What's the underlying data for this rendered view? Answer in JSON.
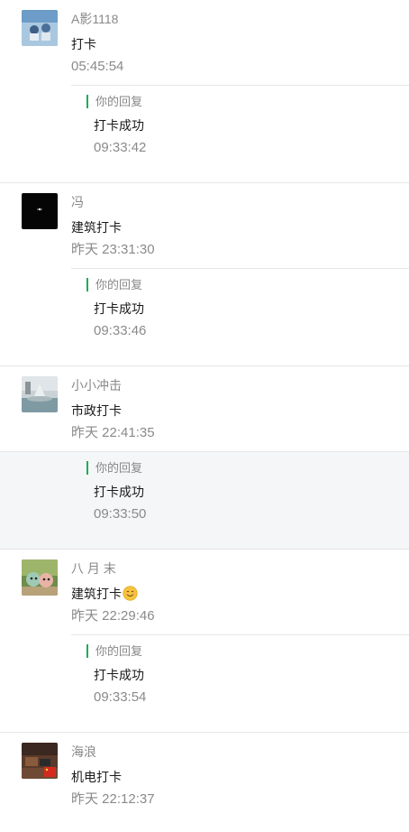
{
  "entries": [
    {
      "name": "A影1118",
      "message": "打卡",
      "time": "05:45:54",
      "avatar_icon": "avatar-beach-photo",
      "reply": {
        "label": "你的回复",
        "text": "打卡成功",
        "time": "09:33:42"
      }
    },
    {
      "name": "冯",
      "message": "建筑打卡",
      "time": "昨天 23:31:30",
      "avatar_icon": "avatar-black-photo",
      "reply": {
        "label": "你的回复",
        "text": "打卡成功",
        "time": "09:33:46"
      }
    },
    {
      "name": "小小冲击",
      "message": "市政打卡",
      "time": "昨天 22:41:35",
      "avatar_icon": "avatar-fountain-photo",
      "reply": {
        "label": "你的回复",
        "text": "打卡成功",
        "time": "09:33:50"
      }
    },
    {
      "name": "八 月 末",
      "message": "建筑打卡",
      "message_emoji": "smiling-face-emoji",
      "time": "昨天 22:29:46",
      "avatar_icon": "avatar-toys-photo",
      "reply": {
        "label": "你的回复",
        "text": "打卡成功",
        "time": "09:33:54"
      }
    },
    {
      "name": "海浪",
      "message": "机电打卡",
      "time": "昨天 22:12:37",
      "avatar_icon": "avatar-room-photo"
    }
  ],
  "colors": {
    "reply_accent": "#1aad5a",
    "highlight_background": "#f5f6f8",
    "divider": "#e6e6e6"
  }
}
